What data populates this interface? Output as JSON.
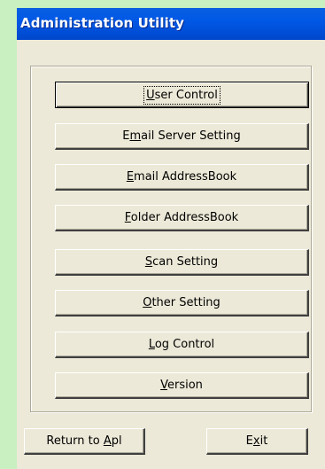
{
  "window": {
    "title": "Administration Utility"
  },
  "buttons": [
    {
      "name": "user-control-button",
      "pre": "",
      "key": "U",
      "post": "ser Control",
      "focused": true
    },
    {
      "name": "email-server-setting-button",
      "pre": "E",
      "key": "m",
      "post": "ail Server Setting",
      "focused": false
    },
    {
      "name": "email-addressbook-button",
      "pre": "",
      "key": "E",
      "post": "mail AddressBook",
      "focused": false
    },
    {
      "name": "folder-addressbook-button",
      "pre": "",
      "key": "F",
      "post": "older AddressBook",
      "focused": false
    },
    {
      "name": "scan-setting-button",
      "pre": "",
      "key": "S",
      "post": "can Setting",
      "focused": false
    },
    {
      "name": "other-setting-button",
      "pre": "",
      "key": "O",
      "post": "ther Setting",
      "focused": false
    },
    {
      "name": "log-control-button",
      "pre": "",
      "key": "L",
      "post": "og Control",
      "focused": false
    },
    {
      "name": "version-button",
      "pre": "",
      "key": "V",
      "post": "ersion",
      "focused": false
    }
  ],
  "footer": {
    "return_button": {
      "pre": "Return to ",
      "key": "A",
      "post": "pl"
    },
    "exit_button": {
      "pre": "E",
      "key": "x",
      "post": "it"
    }
  }
}
